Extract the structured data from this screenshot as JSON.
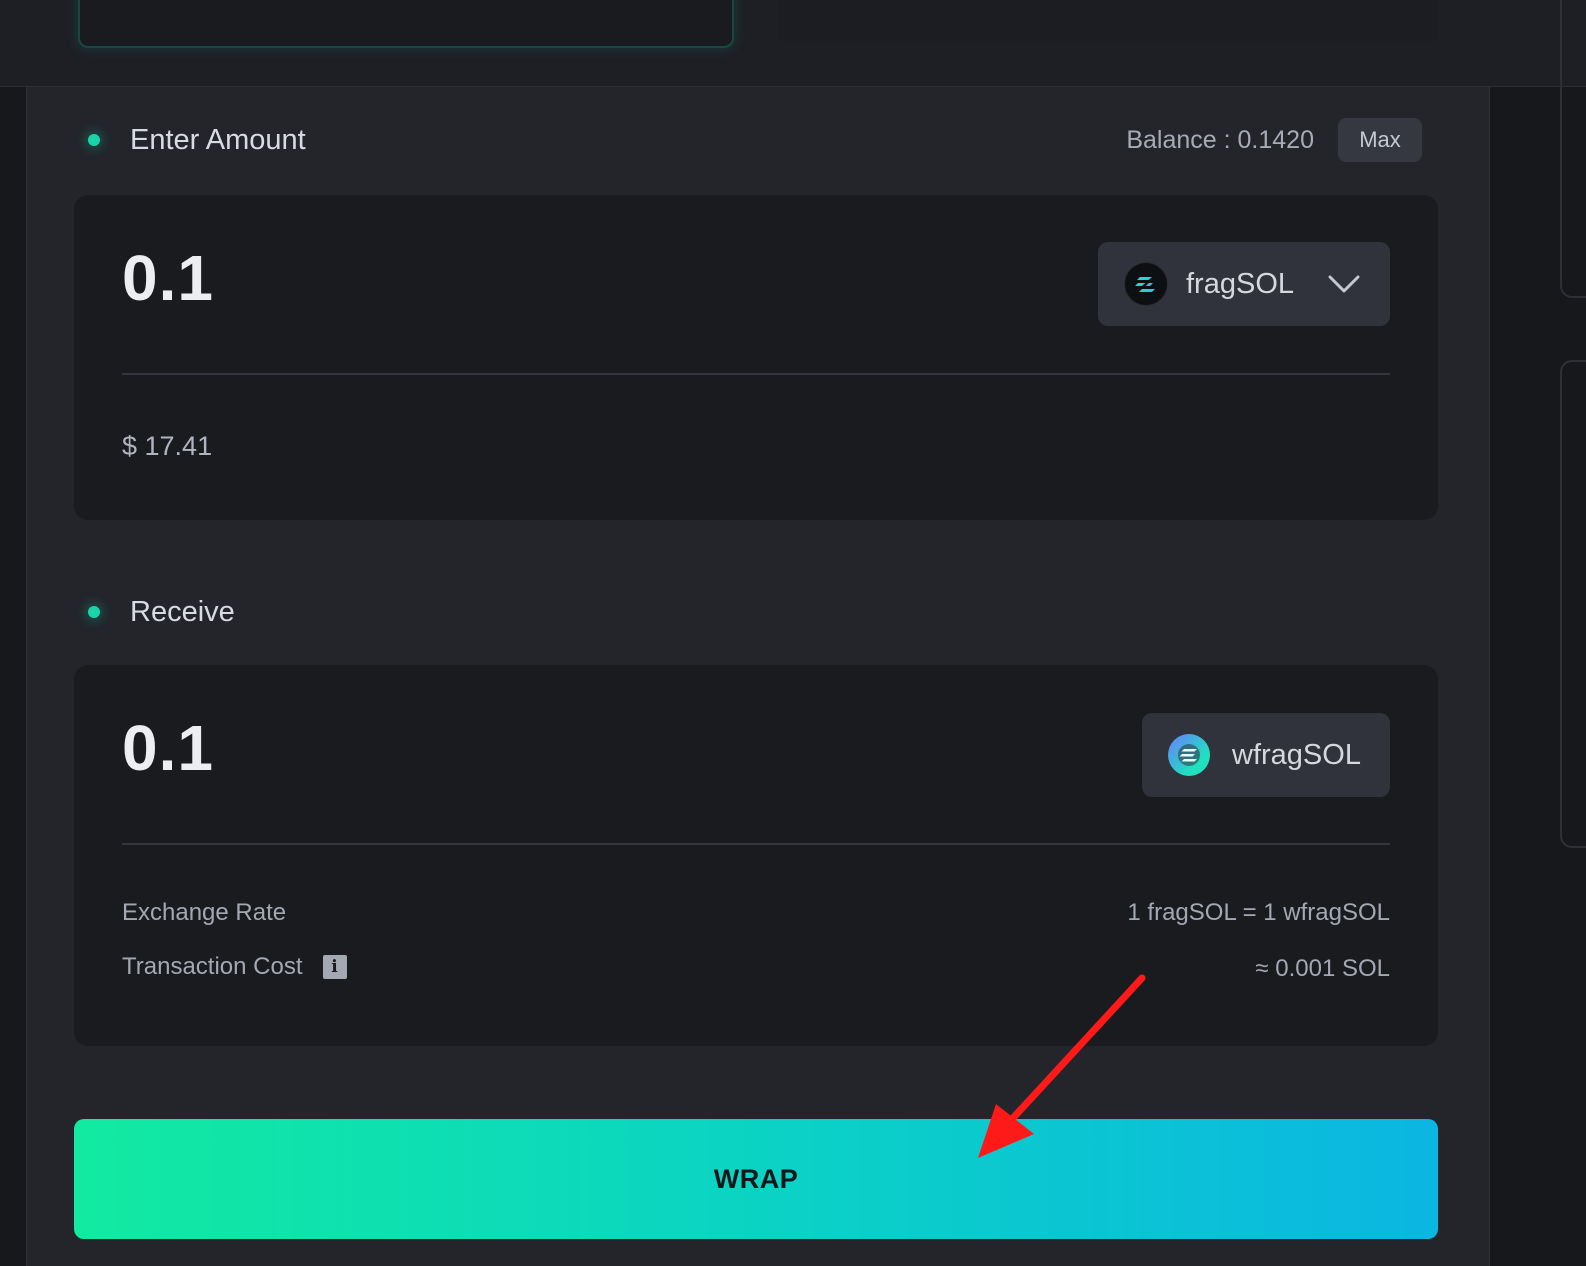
{
  "enter_section": {
    "label": "Enter Amount",
    "balance": "Balance : 0.1420",
    "max_label": "Max",
    "amount": "0.1",
    "token": {
      "name": "fragSOL",
      "icon": "fragsol-token-icon"
    },
    "usd_value": "$ 17.41"
  },
  "receive_section": {
    "label": "Receive",
    "amount": "0.1",
    "token": {
      "name": "wfragSOL",
      "icon": "wfragsol-token-icon"
    },
    "exchange_rate_label": "Exchange Rate",
    "exchange_rate_value": "1 fragSOL = 1 wfragSOL",
    "tx_cost_label": "Transaction Cost",
    "tx_cost_value": "≈ 0.001 SOL"
  },
  "wrap_button": {
    "label": "WRAP"
  },
  "colors": {
    "accent": "#18d4a6",
    "button_gradient_start": "#12eaa0",
    "button_gradient_end": "#0bb6e2",
    "annotation_arrow": "#ff1a1a"
  }
}
